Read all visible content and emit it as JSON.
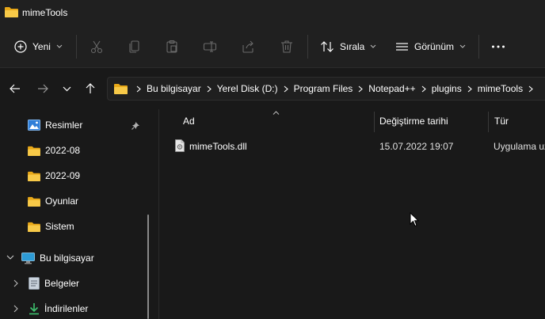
{
  "window": {
    "title": "mimeTools"
  },
  "toolbar": {
    "new_label": "Yeni",
    "sort_label": "Sırala",
    "view_label": "Görünüm",
    "icons": [
      "plus-circle-icon",
      "cut-icon",
      "copy-icon",
      "paste-icon",
      "rename-icon",
      "share-icon",
      "delete-icon",
      "sort-icon",
      "view-icon",
      "more-icon"
    ]
  },
  "breadcrumb": [
    "Bu bilgisayar",
    "Yerel Disk (D:)",
    "Program Files",
    "Notepad++",
    "plugins",
    "mimeTools"
  ],
  "sidebar": {
    "items": [
      {
        "label": "Resimler",
        "icon": "pictures-icon",
        "pinned": true
      },
      {
        "label": "2022-08",
        "icon": "folder-icon"
      },
      {
        "label": "2022-09",
        "icon": "folder-icon"
      },
      {
        "label": "Oyunlar",
        "icon": "folder-icon"
      },
      {
        "label": "Sistem",
        "icon": "folder-icon"
      },
      {
        "label": "Bu bilgisayar",
        "icon": "computer-icon",
        "expanded": true
      },
      {
        "label": "Belgeler",
        "icon": "documents-icon"
      },
      {
        "label": "İndirilenler",
        "icon": "downloads-icon"
      }
    ]
  },
  "columns": {
    "name": "Ad",
    "modified": "Değiştirme tarihi",
    "type": "Tür"
  },
  "files": [
    {
      "name": "mimeTools.dll",
      "modified": "15.07.2022 19:07",
      "type": "Uygulama uzantısı"
    }
  ],
  "colors": {
    "folder": "#f4c542",
    "background": "#191919",
    "chrome": "#202020"
  }
}
